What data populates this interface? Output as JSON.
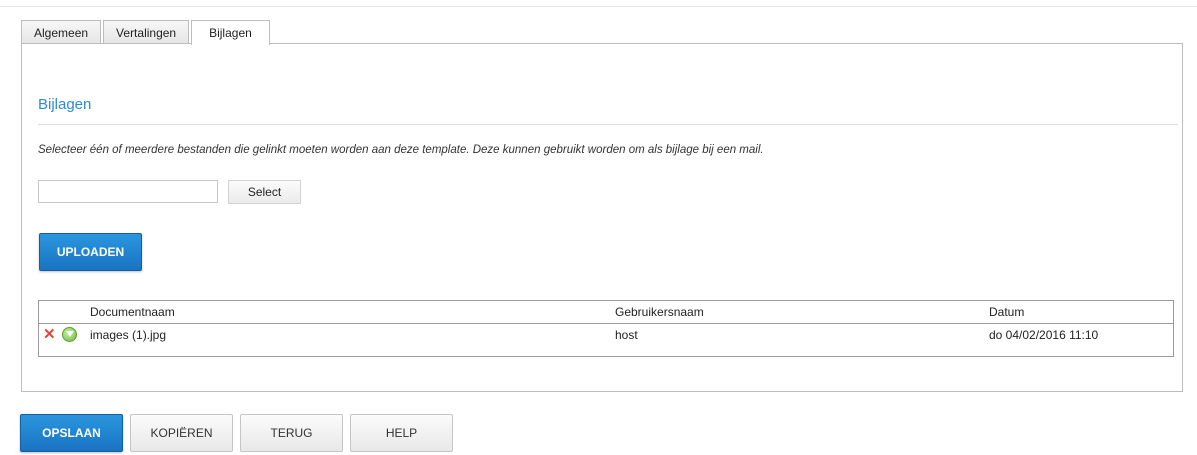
{
  "tabs": [
    {
      "label": "Algemeen",
      "active": false
    },
    {
      "label": "Vertalingen",
      "active": false
    },
    {
      "label": "Bijlagen",
      "active": true
    }
  ],
  "section": {
    "title": "Bijlagen",
    "description": "Selecteer één of meerdere bestanden die gelinkt moeten worden aan deze template. Deze kunnen gebruikt worden om als bijlage bij een mail."
  },
  "file_input": {
    "value": "",
    "select_label": "Select"
  },
  "upload_label": "UPLOADEN",
  "table": {
    "columns": [
      "Documentnaam",
      "Gebruikersnaam",
      "Datum"
    ],
    "rows": [
      {
        "document": "images (1).jpg",
        "user": "host",
        "date": "do 04/02/2016 11:10",
        "icons": [
          "delete-icon",
          "download-icon"
        ]
      }
    ]
  },
  "actions": {
    "save": "OPSLAAN",
    "copy": "KOPIËREN",
    "back": "TERUG",
    "help": "HELP"
  },
  "colors": {
    "accent": "#1a73c2",
    "title": "#2a8dd4",
    "delete": "#e0473c",
    "download": "#6dbb3c"
  }
}
